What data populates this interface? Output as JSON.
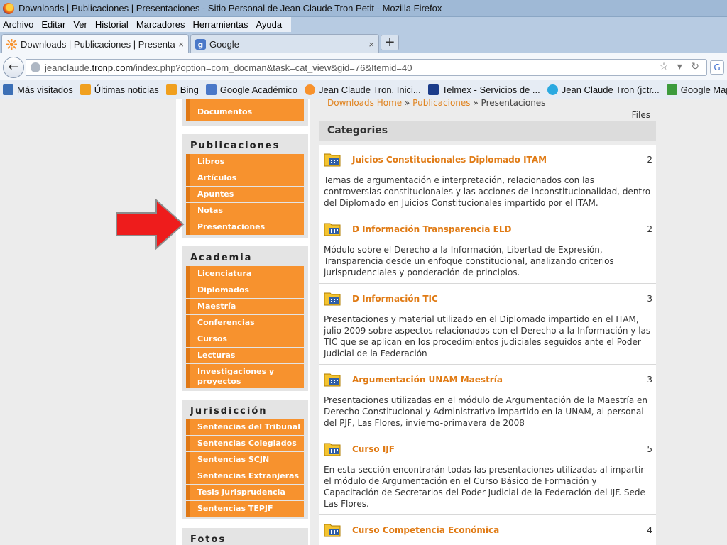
{
  "window": {
    "title": "Downloads | Publicaciones | Presentaciones - Sitio Personal de Jean Claude Tron Petit - Mozilla Firefox"
  },
  "menu": [
    "Archivo",
    "Editar",
    "Ver",
    "Historial",
    "Marcadores",
    "Herramientas",
    "Ayuda"
  ],
  "tabs": [
    {
      "label": "Downloads | Publicaciones | Presenta...",
      "close": "×"
    },
    {
      "label": "Google",
      "close": "×"
    }
  ],
  "new_tab": "+",
  "address": {
    "prefix": "jeanclaude.",
    "domain": "tronp.com",
    "path": "/index.php?option=com_docman&task=cat_view&gid=76&Itemid=40"
  },
  "bookmarks": [
    {
      "label": "Más visitados",
      "icon": "bookmark-star-icon",
      "color": "#3b6fb6"
    },
    {
      "label": "Últimas noticias",
      "icon": "rss-icon",
      "color": "#f0a020"
    },
    {
      "label": "Bing",
      "icon": "bing-icon",
      "color": "#f0a020"
    },
    {
      "label": "Google Académico",
      "icon": "google-scholar-icon",
      "color": "#4a78c8"
    },
    {
      "label": "Jean Claude Tron, Inici...",
      "icon": "site-favicon-icon",
      "color": "#f7922e"
    },
    {
      "label": "Telmex - Servicios de ...",
      "icon": "telmex-icon",
      "color": "#1b3c8a"
    },
    {
      "label": "Jean Claude Tron (jctr...",
      "icon": "twitter-icon",
      "color": "#2aa9e0"
    },
    {
      "label": "Google Maps",
      "icon": "google-maps-icon",
      "color": "#3d9b3d"
    }
  ],
  "sidebar": {
    "top_item": "Documentos",
    "sections": [
      {
        "heading": "Publicaciones",
        "items": [
          "Libros",
          "Artículos",
          "Apuntes",
          "Notas",
          "Presentaciones"
        ]
      },
      {
        "heading": "Academia",
        "items": [
          "Licenciatura",
          "Diplomados",
          "Maestría",
          "Conferencias",
          "Cursos",
          "Lecturas",
          "Investigaciones y proyectos"
        ]
      },
      {
        "heading": "Jurisdicción",
        "items": [
          "Sentencias del Tribunal",
          "Sentencias Colegiados",
          "Sentencias SCJN",
          "Sentencias Extranjeras",
          "Tesis Jurisprudencia",
          "Sentencias TEPJF"
        ]
      },
      {
        "heading": "Fotos",
        "items": []
      }
    ]
  },
  "main": {
    "breadcrumb": {
      "home": "Downloads Home",
      "sep": "»",
      "level1": "Publicaciones",
      "current": "Presentaciones"
    },
    "files_label": "Files",
    "categories_heading": "Categories",
    "categories": [
      {
        "title": "Juicios Constitucionales Diplomado ITAM",
        "count": "2",
        "desc": "Temas de argumentación e interpretación, relacionados con las controversias constitucionales y las acciones de inconstitucionalidad, dentro del Diplomado en Juicios Constitucionales impartido por el ITAM."
      },
      {
        "title": "D Información Transparencia ELD",
        "count": "2",
        "desc": "Módulo sobre el Derecho a la Información, Libertad de Expresión, Transparencia desde un enfoque constitucional, analizando criterios jurisprudenciales y ponderación de principios."
      },
      {
        "title": "D Información TIC",
        "count": "3",
        "desc": "Presentaciones y material utilizado en el Diplomado impartido en el ITAM, julio 2009 sobre aspectos relacionados con el Derecho a la Información y las TIC que se aplican en los procedimientos judiciales seguidos ante el Poder Judicial de la Federación"
      },
      {
        "title": "Argumentación UNAM Maestría",
        "count": "3",
        "desc": "Presentaciones utilizadas en el módulo de Argumentación de la Maestría en Derecho Constitucional y Administrativo impartido en la UNAM, al personal del PJF, Las Flores, invierno-primavera de 2008"
      },
      {
        "title": "Curso IJF",
        "count": "5",
        "desc": "En esta sección encontrarán todas las presentaciones utilizadas al impartir el módulo de Argumentación en el Curso Básico de Formación y Capacitación de Secretarios del Poder Judicial de la Federación del IJF. Sede Las Flores."
      },
      {
        "title": "Curso Competencia Económica",
        "count": "4",
        "desc": ""
      }
    ]
  },
  "colors": {
    "accent": "#f7922e",
    "accent_dark": "#e07916",
    "link": "#e07b15",
    "arrow": "#ee1c1c"
  }
}
